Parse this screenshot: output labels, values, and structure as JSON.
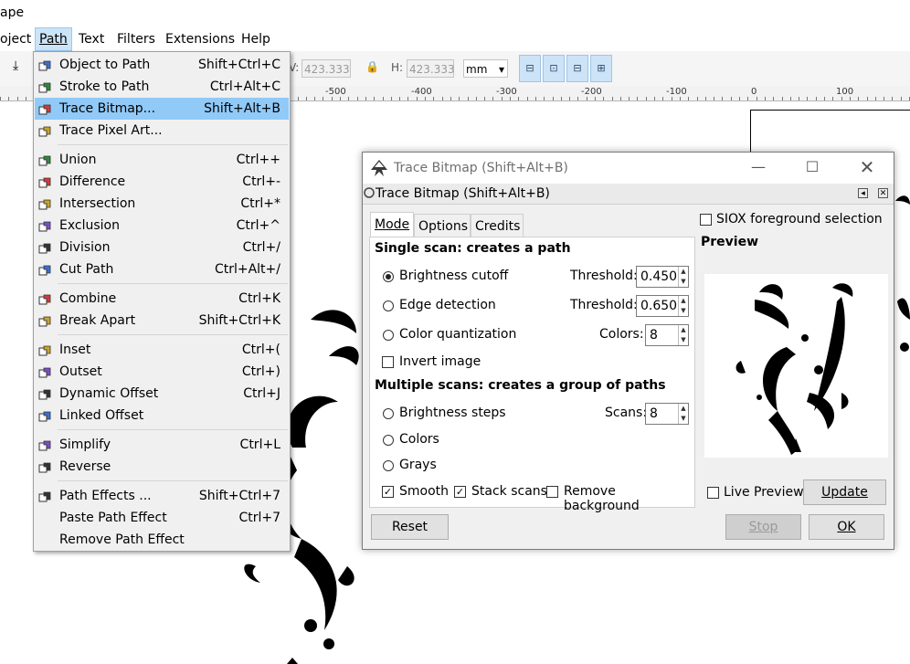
{
  "app": {
    "title_fragment": "ape"
  },
  "menubar": {
    "items": [
      {
        "label": "oject",
        "active": false
      },
      {
        "label": "Path",
        "active": true
      },
      {
        "label": "Text",
        "active": false
      },
      {
        "label": "Filters",
        "active": false
      },
      {
        "label": "Extensions",
        "active": false
      },
      {
        "label": "Help",
        "active": false
      }
    ]
  },
  "toolbar": {
    "w_label": "V:",
    "w_value": "423.333",
    "h_label": "H:",
    "h_value": "423.333",
    "unit": "mm"
  },
  "ruler": {
    "labels": [
      "-500",
      "-400",
      "-300",
      "-200",
      "-100",
      "0",
      "100"
    ]
  },
  "path_menu": {
    "groups": [
      [
        {
          "label": "Object to Path",
          "shortcut": "Shift+Ctrl+C",
          "icon": "object-to-path-icon"
        },
        {
          "label": "Stroke to Path",
          "shortcut": "Ctrl+Alt+C",
          "icon": "stroke-to-path-icon"
        },
        {
          "label": "Trace Bitmap...",
          "shortcut": "Shift+Alt+B",
          "icon": "trace-bitmap-icon",
          "highlighted": true
        },
        {
          "label": "Trace Pixel Art...",
          "shortcut": "",
          "icon": "trace-pixel-art-icon"
        }
      ],
      [
        {
          "label": "Union",
          "shortcut": "Ctrl++",
          "icon": "union-icon"
        },
        {
          "label": "Difference",
          "shortcut": "Ctrl+-",
          "icon": "difference-icon"
        },
        {
          "label": "Intersection",
          "shortcut": "Ctrl+*",
          "icon": "intersection-icon"
        },
        {
          "label": "Exclusion",
          "shortcut": "Ctrl+^",
          "icon": "exclusion-icon"
        },
        {
          "label": "Division",
          "shortcut": "Ctrl+/",
          "icon": "division-icon"
        },
        {
          "label": "Cut Path",
          "shortcut": "Ctrl+Alt+/",
          "icon": "cut-path-icon"
        }
      ],
      [
        {
          "label": "Combine",
          "shortcut": "Ctrl+K",
          "icon": "combine-icon"
        },
        {
          "label": "Break Apart",
          "shortcut": "Shift+Ctrl+K",
          "icon": "break-apart-icon"
        }
      ],
      [
        {
          "label": "Inset",
          "shortcut": "Ctrl+(",
          "icon": "inset-icon"
        },
        {
          "label": "Outset",
          "shortcut": "Ctrl+)",
          "icon": "outset-icon"
        },
        {
          "label": "Dynamic Offset",
          "shortcut": "Ctrl+J",
          "icon": "dynamic-offset-icon"
        },
        {
          "label": "Linked Offset",
          "shortcut": "",
          "icon": "linked-offset-icon"
        }
      ],
      [
        {
          "label": "Simplify",
          "shortcut": "Ctrl+L",
          "icon": "simplify-icon"
        },
        {
          "label": "Reverse",
          "shortcut": "",
          "icon": "reverse-icon"
        }
      ],
      [
        {
          "label": "Path Effects ...",
          "shortcut": "Shift+Ctrl+7",
          "icon": "path-effects-icon"
        },
        {
          "label": "Paste Path Effect",
          "shortcut": "Ctrl+7",
          "icon": ""
        },
        {
          "label": "Remove Path Effect",
          "shortcut": "",
          "icon": ""
        }
      ]
    ]
  },
  "trace_dialog": {
    "window_title": "Trace Bitmap (Shift+Alt+B)",
    "panel_title": "Trace Bitmap (Shift+Alt+B)",
    "tabs": [
      "Mode",
      "Options",
      "Credits"
    ],
    "active_tab": "Mode",
    "single_scan_heading": "Single scan: creates a path",
    "brightness_cutoff": "Brightness cutoff",
    "edge_detection": "Edge detection",
    "color_quantization": "Color quantization",
    "threshold_label": "Threshold:",
    "brightness_threshold": "0.450",
    "edge_threshold": "0.650",
    "colors_label": "Colors:",
    "colors_value": "8",
    "invert_image": "Invert image",
    "multi_scan_heading": "Multiple scans: creates a group of paths",
    "brightness_steps": "Brightness steps",
    "scans_label": "Scans:",
    "scans_value": "8",
    "colors_option": "Colors",
    "grays_option": "Grays",
    "smooth": "Smooth",
    "stack_scans": "Stack scans",
    "remove_background": "Remove background",
    "siox": "SIOX foreground selection",
    "preview_label": "Preview",
    "live_preview": "Live Preview",
    "update": "Update",
    "reset": "Reset",
    "stop": "Stop",
    "ok": "OK",
    "selected_mode": "brightness_cutoff",
    "smooth_checked": true,
    "stack_checked": true,
    "remove_bg_checked": false,
    "invert_checked": false,
    "siox_checked": false,
    "live_checked": false
  },
  "colors": {
    "menu_highlight": "#91c9f7",
    "menubar_active": "#cce4f7"
  }
}
